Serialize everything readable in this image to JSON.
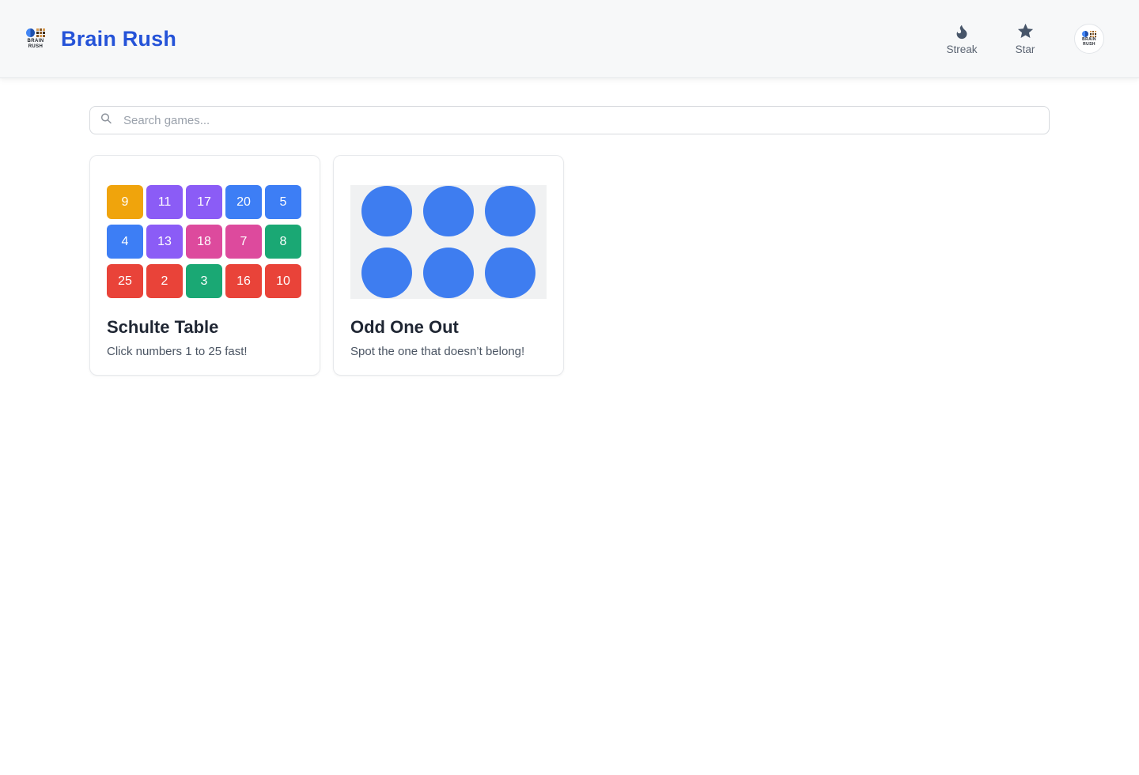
{
  "brand": {
    "title": "Brain Rush",
    "logo_line1": "BRAIN",
    "logo_line2": "RUSH"
  },
  "header": {
    "streak_label": "Streak",
    "star_label": "Star"
  },
  "search": {
    "placeholder": "Search games..."
  },
  "games": [
    {
      "title": "Schulte Table",
      "subtitle": "Click numbers 1 to 25 fast!",
      "thumbnail": {
        "type": "number-grid",
        "columns": 5,
        "rows": 3,
        "tiles": [
          {
            "n": "9",
            "color": "#f0a40c"
          },
          {
            "n": "11",
            "color": "#8b5cf6"
          },
          {
            "n": "17",
            "color": "#8b5cf6"
          },
          {
            "n": "20",
            "color": "#3d7ef5"
          },
          {
            "n": "5",
            "color": "#3d7ef5"
          },
          {
            "n": "4",
            "color": "#3d7ef5"
          },
          {
            "n": "13",
            "color": "#8b5cf6"
          },
          {
            "n": "18",
            "color": "#dd4a9d"
          },
          {
            "n": "7",
            "color": "#dd4a9d"
          },
          {
            "n": "8",
            "color": "#1aa874"
          },
          {
            "n": "25",
            "color": "#e94339"
          },
          {
            "n": "2",
            "color": "#e94339"
          },
          {
            "n": "3",
            "color": "#1aa874"
          },
          {
            "n": "16",
            "color": "#e94339"
          },
          {
            "n": "10",
            "color": "#e94339"
          }
        ]
      }
    },
    {
      "title": "Odd One Out",
      "subtitle": "Spot the one that doesn’t belong!",
      "thumbnail": {
        "type": "circle-grid",
        "circle_count": 6,
        "circle_color": "#3e7df0",
        "panel_color": "#f0f1f2"
      }
    }
  ],
  "colors": {
    "accent_blue": "#2553d8",
    "header_background": "#f7f8f9",
    "icon_slate": "#475569",
    "circle_blue": "#3e7df0",
    "panel_gray": "#f0f1f2"
  }
}
